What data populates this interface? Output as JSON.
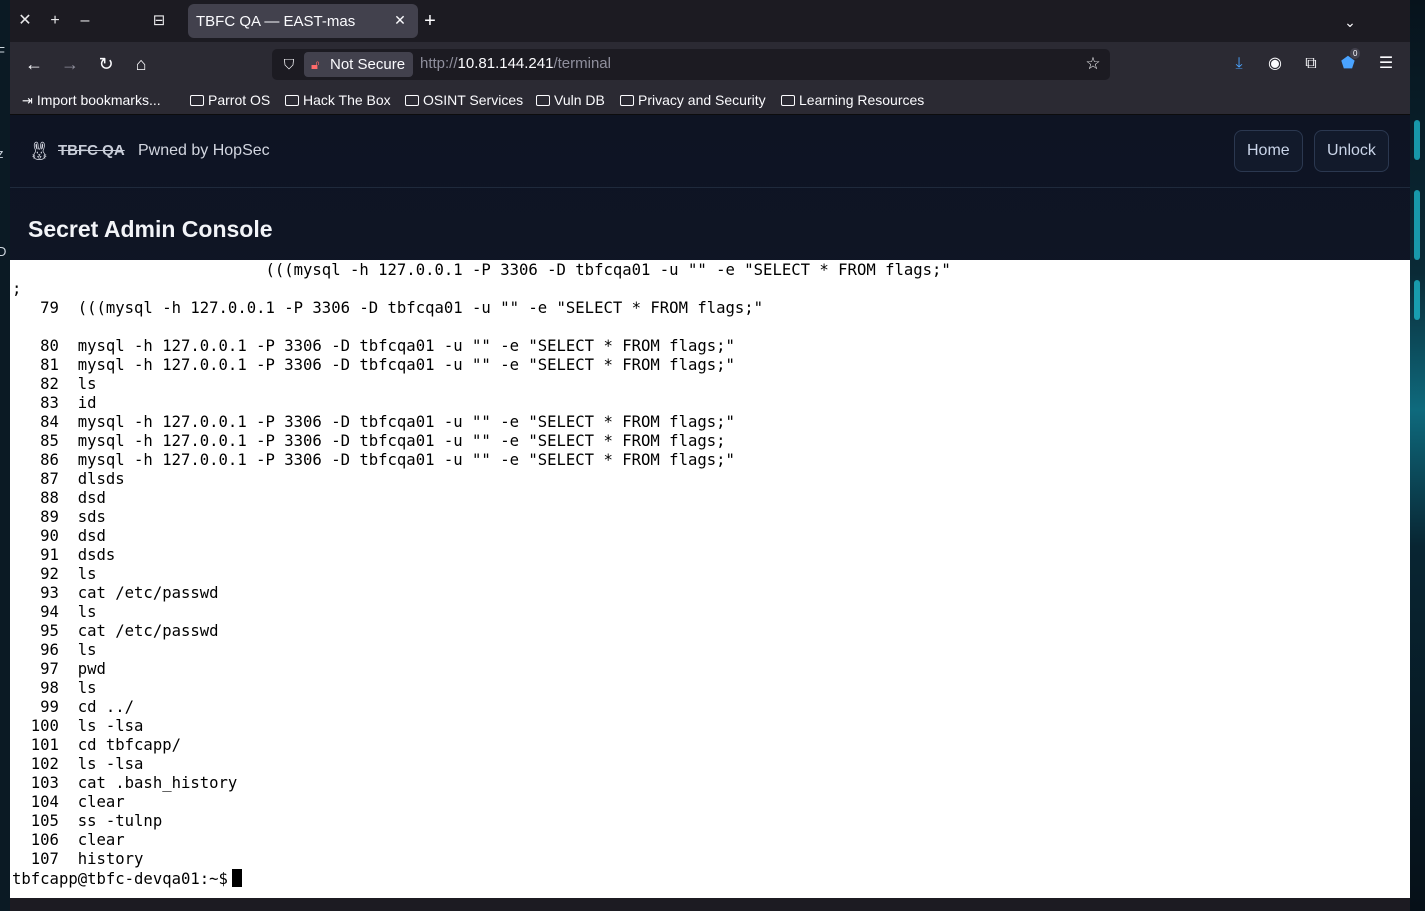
{
  "browser": {
    "tab_title": "TBFC QA — EAST-mas",
    "not_secure_label": "Not Secure",
    "url_prefix": "http://",
    "url_host": "10.81.144.241",
    "url_path": "/terminal",
    "extension_badge": "0",
    "bookmarks": [
      {
        "label": "Import bookmarks...",
        "icon": "import-icon"
      },
      {
        "label": "Parrot OS",
        "icon": "folder-icon"
      },
      {
        "label": "Hack The Box",
        "icon": "folder-icon"
      },
      {
        "label": "OSINT Services",
        "icon": "folder-icon"
      },
      {
        "label": "Vuln DB",
        "icon": "folder-icon"
      },
      {
        "label": "Privacy and Security",
        "icon": "folder-icon"
      },
      {
        "label": "Learning Resources",
        "icon": "folder-icon"
      }
    ]
  },
  "site": {
    "brand_struck": "TBFC QA",
    "brand_tagline": "Pwned by HopSec",
    "nav": {
      "home": "Home",
      "unlock": "Unlock"
    },
    "console_title": "Secret Admin Console"
  },
  "terminal": {
    "lines": [
      "                           (((mysql -h 127.0.0.1 -P 3306 -D tbfcqa01 -u \"\" -e \"SELECT * FROM flags;\"",
      ";",
      "   79  (((mysql -h 127.0.0.1 -P 3306 -D tbfcqa01 -u \"\" -e \"SELECT * FROM flags;\"",
      "",
      "   80  mysql -h 127.0.0.1 -P 3306 -D tbfcqa01 -u \"\" -e \"SELECT * FROM flags;\"",
      "   81  mysql -h 127.0.0.1 -P 3306 -D tbfcqa01 -u \"\" -e \"SELECT * FROM flags;\"",
      "   82  ls",
      "   83  id",
      "   84  mysql -h 127.0.0.1 -P 3306 -D tbfcqa01 -u \"\" -e \"SELECT * FROM flags;\"",
      "   85  mysql -h 127.0.0.1 -P 3306 -D tbfcqa01 -u \"\" -e \"SELECT * FROM flags;",
      "   86  mysql -h 127.0.0.1 -P 3306 -D tbfcqa01 -u \"\" -e \"SELECT * FROM flags;\"",
      "   87  dlsds",
      "   88  dsd",
      "   89  sds",
      "   90  dsd",
      "   91  dsds",
      "   92  ls",
      "   93  cat /etc/passwd",
      "   94  ls",
      "   95  cat /etc/passwd",
      "   96  ls",
      "   97  pwd",
      "   98  ls",
      "   99  cd ../",
      "  100  ls -lsa",
      "  101  cd tbfcapp/",
      "  102  ls -lsa",
      "  103  cat .bash_history",
      "  104  clear",
      "  105  ss -tulnp",
      "  106  clear",
      "  107  history"
    ],
    "prompt": "tbfcapp@tbfc-devqa01:~$"
  }
}
